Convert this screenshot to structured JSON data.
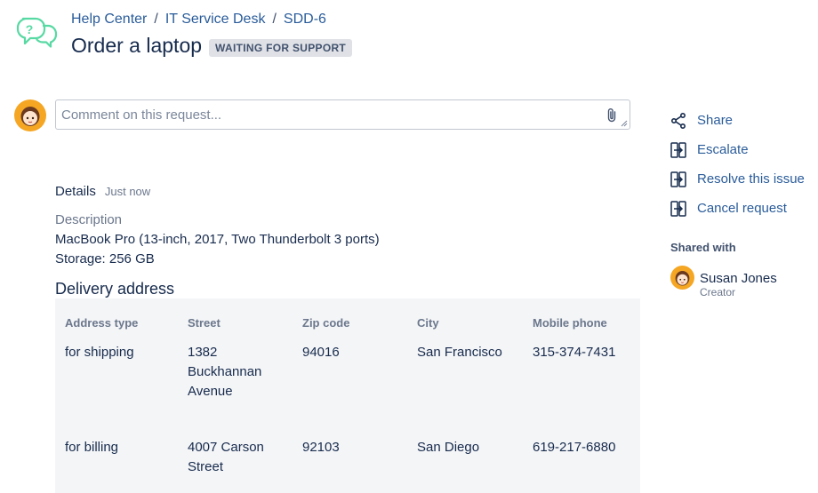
{
  "breadcrumb": {
    "items": [
      "Help Center",
      "IT Service Desk",
      "SDD-6"
    ],
    "separator": "/"
  },
  "request": {
    "title": "Order a laptop",
    "status": "WAITING FOR SUPPORT"
  },
  "comment": {
    "placeholder": "Comment on this request..."
  },
  "details": {
    "label": "Details",
    "time": "Just now",
    "description_label": "Description",
    "description_line1": "MacBook Pro (13-inch, 2017, Two Thunderbolt 3 ports)",
    "description_line2": "Storage: 256 GB"
  },
  "delivery": {
    "title": "Delivery address",
    "headers": [
      "Address type",
      "Street",
      "Zip code",
      "City",
      "Mobile phone"
    ],
    "rows": [
      {
        "type": "for shipping",
        "street_1": "1382",
        "street_2": "Buckhannan",
        "street_3": "Avenue",
        "zip": "94016",
        "city": "San Francisco",
        "phone": "315-374-7431"
      },
      {
        "type": "for billing",
        "street_1": "4007 Carson",
        "street_2": "Street",
        "zip": "92103",
        "city": "San Diego",
        "phone": "619-217-6880"
      }
    ]
  },
  "actions": {
    "share": "Share",
    "escalate": "Escalate",
    "resolve": "Resolve this issue",
    "cancel": "Cancel request"
  },
  "shared": {
    "label": "Shared with",
    "name": "Susan Jones",
    "role": "Creator"
  },
  "colors": {
    "link": "#2a5c9a",
    "text": "#172b4d",
    "muted": "#6b778c",
    "badge_bg": "#dfe1e6",
    "table_bg": "#f4f5f7",
    "logo": "#57d9a3",
    "avatar_bg": "#f5a623"
  }
}
